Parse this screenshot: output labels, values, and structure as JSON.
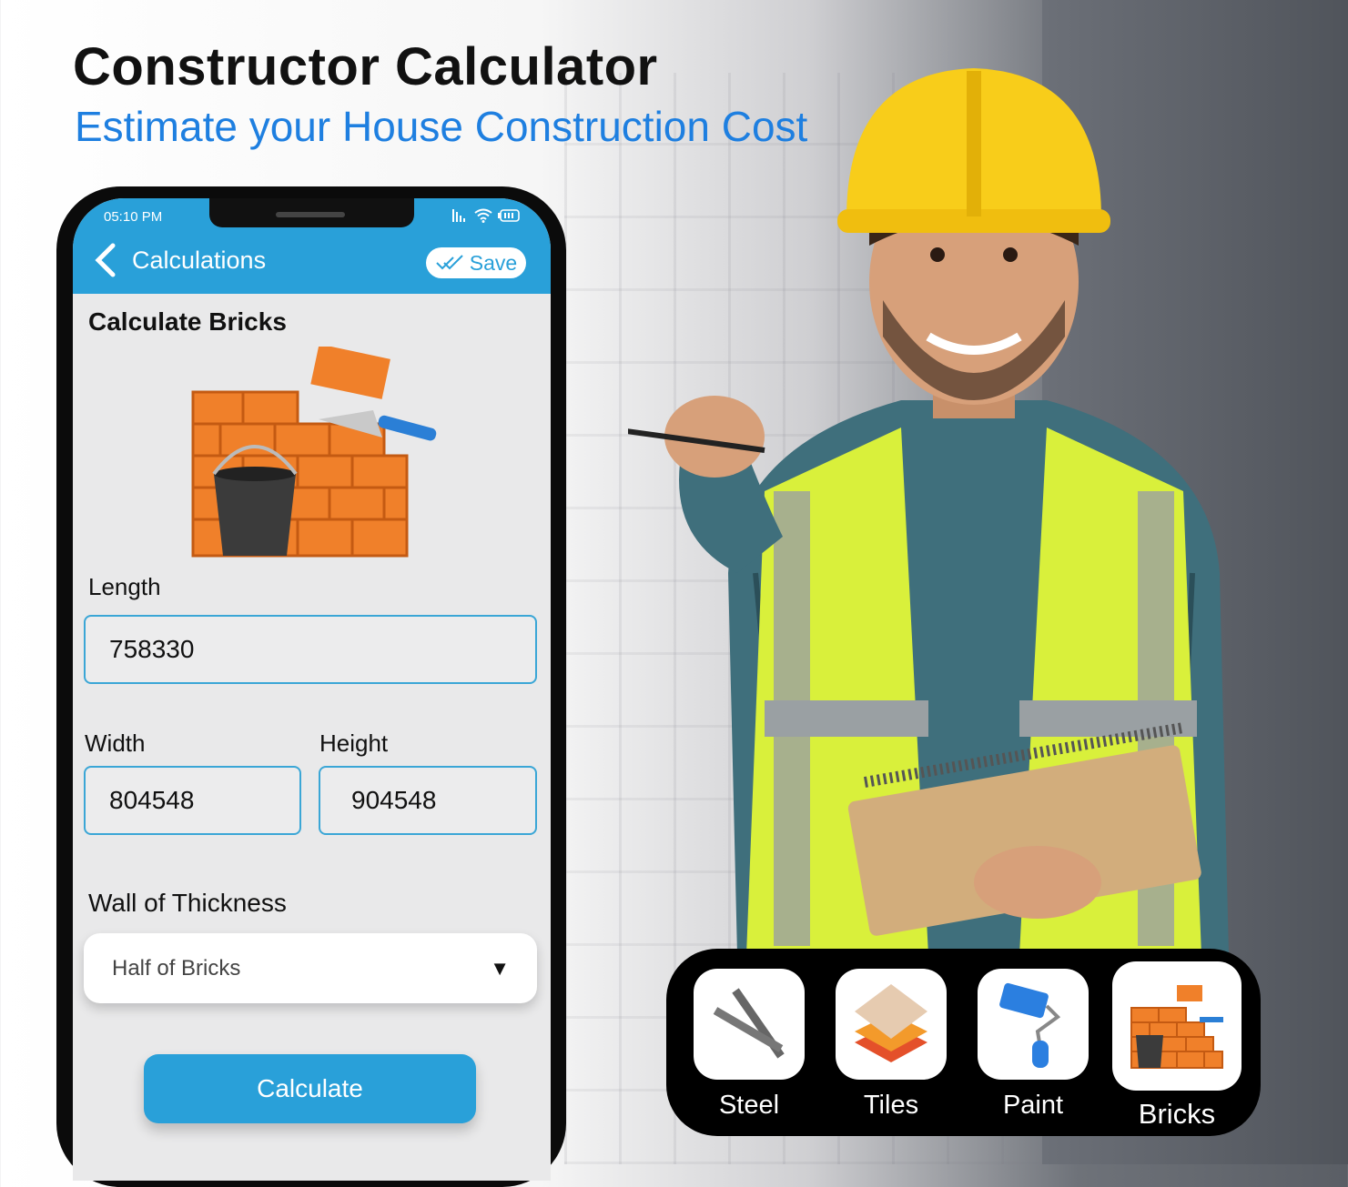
{
  "banner": {
    "title": "Constructor Calculator",
    "subtitle": "Estimate your House Construction Cost"
  },
  "colors": {
    "accent": "#29a0d9",
    "subtitle": "#1e7fe0",
    "brick": "#f0802a"
  },
  "phone": {
    "status_bar": {
      "time": "05:10 PM",
      "icons": [
        "signal-icon",
        "wifi-icon",
        "battery-icon"
      ]
    },
    "app_bar": {
      "title": "Calculations",
      "save_label": "Save"
    },
    "section_title": "Calculate Bricks",
    "form": {
      "length": {
        "label": "Length",
        "value": "758330"
      },
      "width": {
        "label": "Width",
        "value": "804548"
      },
      "height": {
        "label": "Height",
        "value": "904548"
      },
      "thickness": {
        "label": "Wall of Thickness",
        "selected": "Half of Bricks"
      }
    },
    "calculate_label": "Calculate"
  },
  "categories": [
    {
      "label": "Steel",
      "icon": "steel-bars-icon"
    },
    {
      "label": "Tiles",
      "icon": "tiles-icon"
    },
    {
      "label": "Paint",
      "icon": "paint-roller-icon"
    },
    {
      "label": "Bricks",
      "icon": "bricks-icon",
      "active": true
    }
  ]
}
